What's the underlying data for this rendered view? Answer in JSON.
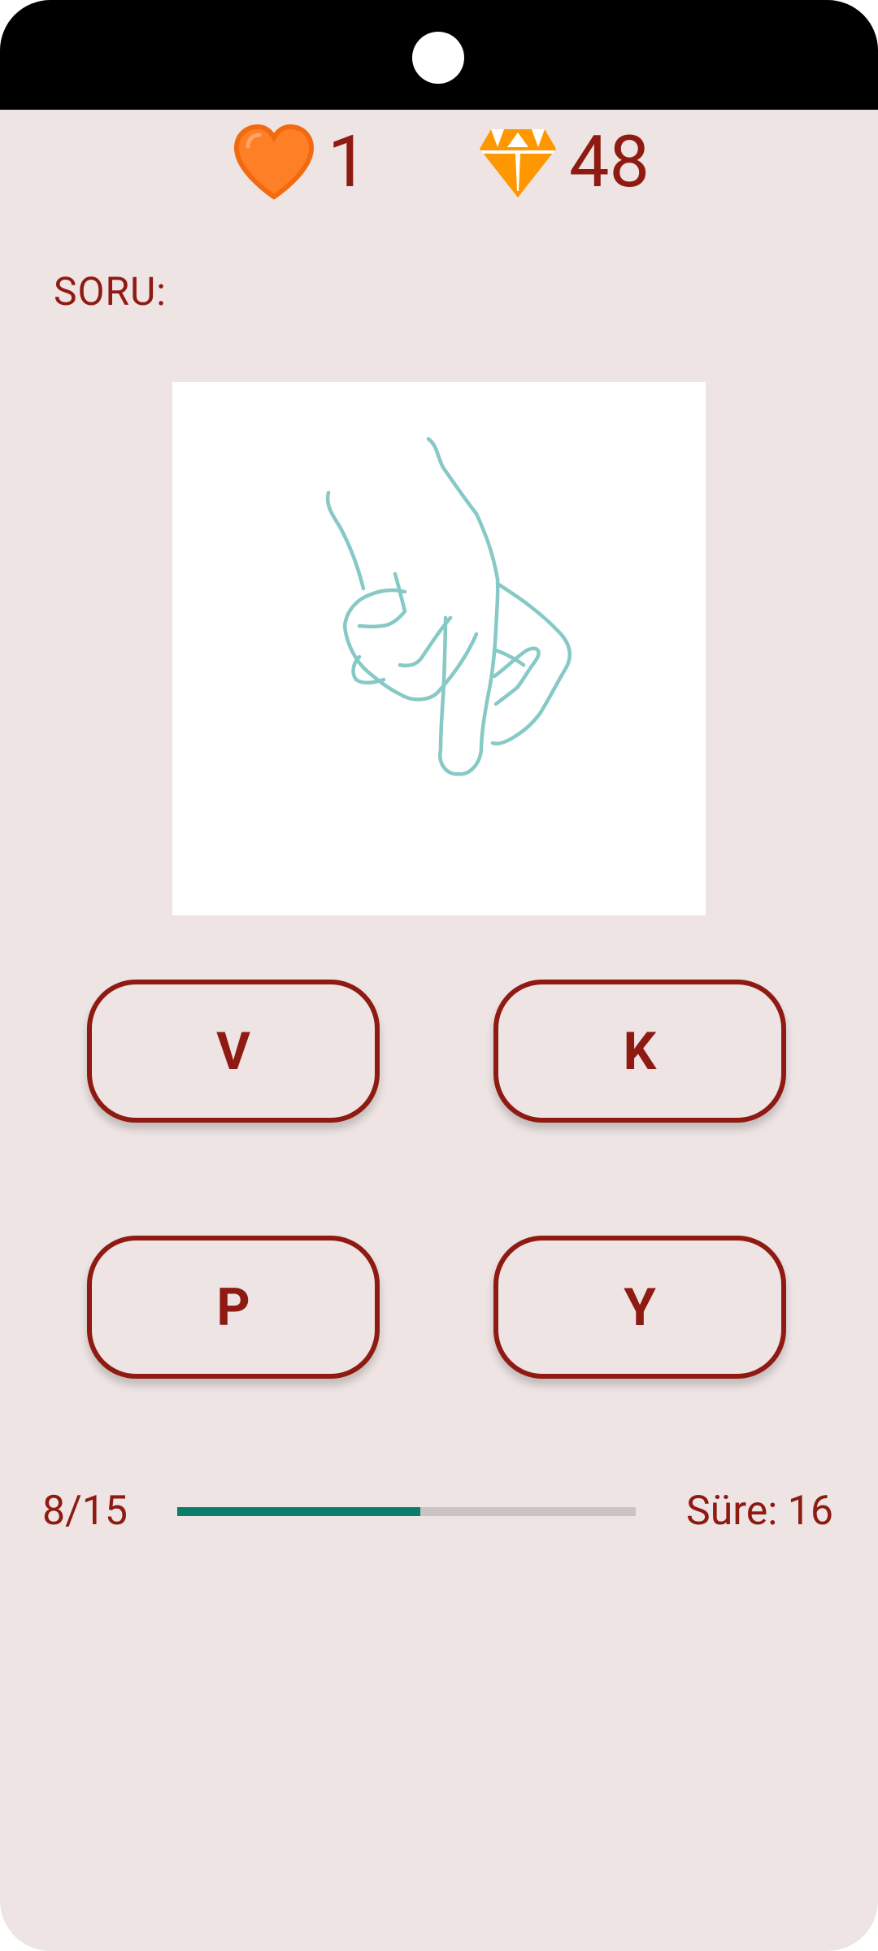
{
  "header": {
    "lives": "1",
    "gems": "48",
    "icons": {
      "lives": "heart-icon",
      "gems": "diamond-icon"
    },
    "colors": {
      "heart": "#ff7f27",
      "diamond": "#ff9800"
    }
  },
  "question": {
    "label": "SORU:",
    "image": "hand-sign-image"
  },
  "answers": [
    {
      "label": "V"
    },
    {
      "label": "K"
    },
    {
      "label": "P"
    },
    {
      "label": "Y"
    }
  ],
  "progress": {
    "counter": "8/15",
    "current": 8,
    "total": 15,
    "fraction": 0.53
  },
  "timer": {
    "label": "Süre: 16"
  },
  "colors": {
    "accent": "#8e1a12",
    "background": "#ede4e3",
    "progress": "#0a7d6b"
  }
}
